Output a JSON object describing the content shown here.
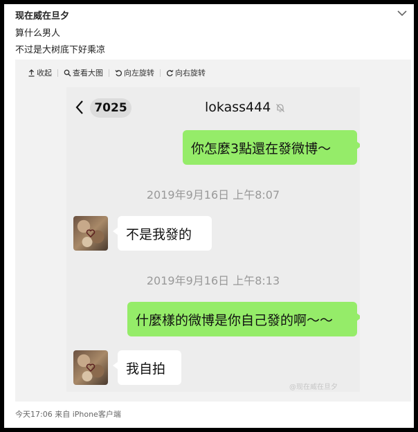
{
  "post": {
    "author": "现在威在旦夕",
    "line1": "算什么男人",
    "line2": "不过是大树底下好乘凉"
  },
  "toolbar": {
    "collapse": "收起",
    "view_large": "查看大图",
    "rotate_left": "向左旋转",
    "rotate_right": "向右旋转"
  },
  "chat": {
    "back_count": "7025",
    "contact_name": "lokass444",
    "messages": [
      {
        "side": "right",
        "text": "你怎麼3點還在發微博～"
      },
      {
        "type": "time",
        "text": "2019年9月16日 上午8:07"
      },
      {
        "side": "left",
        "text": "不是我發的"
      },
      {
        "type": "time",
        "text": "2019年9月16日 上午8:13"
      },
      {
        "side": "right",
        "text": "什麼樣的微博是你自己發的啊～～"
      },
      {
        "side": "left",
        "text": "我自拍"
      }
    ],
    "watermark": "@现在威在旦夕"
  },
  "footer": {
    "meta": "今天17:06  来自 iPhone客户端"
  }
}
